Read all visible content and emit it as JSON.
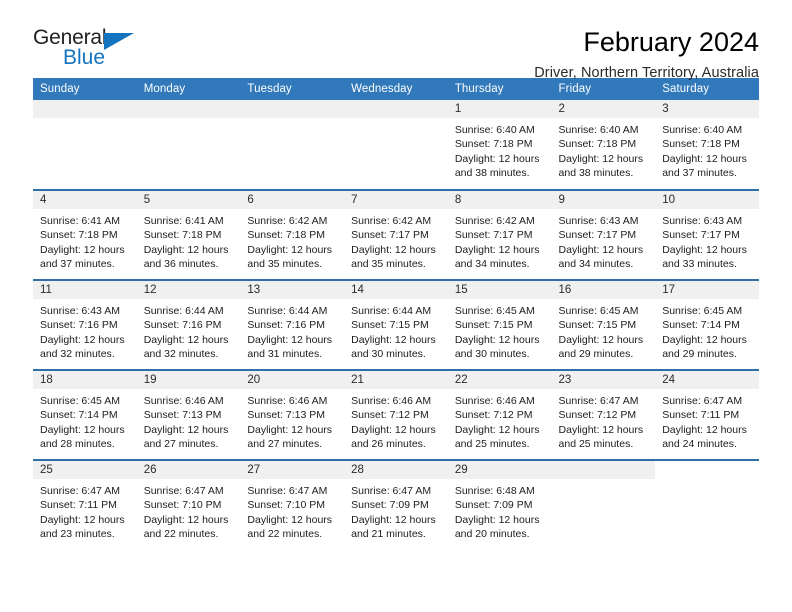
{
  "brand": {
    "name_part1": "General",
    "name_part2": "Blue",
    "triangle_icon": "triangle-icon",
    "accent_color": "#1574bf"
  },
  "header": {
    "title": "February 2024",
    "subtitle": "Driver, Northern Territory, Australia"
  },
  "colors": {
    "header_blue": "#3179ba",
    "row_border_blue": "#2e6fa7",
    "daynum_band": "#f0f0f0"
  },
  "weekdays": [
    "Sunday",
    "Monday",
    "Tuesday",
    "Wednesday",
    "Thursday",
    "Friday",
    "Saturday"
  ],
  "weeks": [
    [
      {
        "day": "",
        "blank": true
      },
      {
        "day": "",
        "blank": true
      },
      {
        "day": "",
        "blank": true
      },
      {
        "day": "",
        "blank": true
      },
      {
        "day": "1",
        "sunrise": "Sunrise: 6:40 AM",
        "sunset": "Sunset: 7:18 PM",
        "daylight1": "Daylight: 12 hours",
        "daylight2": "and 38 minutes."
      },
      {
        "day": "2",
        "sunrise": "Sunrise: 6:40 AM",
        "sunset": "Sunset: 7:18 PM",
        "daylight1": "Daylight: 12 hours",
        "daylight2": "and 38 minutes."
      },
      {
        "day": "3",
        "sunrise": "Sunrise: 6:40 AM",
        "sunset": "Sunset: 7:18 PM",
        "daylight1": "Daylight: 12 hours",
        "daylight2": "and 37 minutes."
      }
    ],
    [
      {
        "day": "4",
        "sunrise": "Sunrise: 6:41 AM",
        "sunset": "Sunset: 7:18 PM",
        "daylight1": "Daylight: 12 hours",
        "daylight2": "and 37 minutes."
      },
      {
        "day": "5",
        "sunrise": "Sunrise: 6:41 AM",
        "sunset": "Sunset: 7:18 PM",
        "daylight1": "Daylight: 12 hours",
        "daylight2": "and 36 minutes."
      },
      {
        "day": "6",
        "sunrise": "Sunrise: 6:42 AM",
        "sunset": "Sunset: 7:18 PM",
        "daylight1": "Daylight: 12 hours",
        "daylight2": "and 35 minutes."
      },
      {
        "day": "7",
        "sunrise": "Sunrise: 6:42 AM",
        "sunset": "Sunset: 7:17 PM",
        "daylight1": "Daylight: 12 hours",
        "daylight2": "and 35 minutes."
      },
      {
        "day": "8",
        "sunrise": "Sunrise: 6:42 AM",
        "sunset": "Sunset: 7:17 PM",
        "daylight1": "Daylight: 12 hours",
        "daylight2": "and 34 minutes."
      },
      {
        "day": "9",
        "sunrise": "Sunrise: 6:43 AM",
        "sunset": "Sunset: 7:17 PM",
        "daylight1": "Daylight: 12 hours",
        "daylight2": "and 34 minutes."
      },
      {
        "day": "10",
        "sunrise": "Sunrise: 6:43 AM",
        "sunset": "Sunset: 7:17 PM",
        "daylight1": "Daylight: 12 hours",
        "daylight2": "and 33 minutes."
      }
    ],
    [
      {
        "day": "11",
        "sunrise": "Sunrise: 6:43 AM",
        "sunset": "Sunset: 7:16 PM",
        "daylight1": "Daylight: 12 hours",
        "daylight2": "and 32 minutes."
      },
      {
        "day": "12",
        "sunrise": "Sunrise: 6:44 AM",
        "sunset": "Sunset: 7:16 PM",
        "daylight1": "Daylight: 12 hours",
        "daylight2": "and 32 minutes."
      },
      {
        "day": "13",
        "sunrise": "Sunrise: 6:44 AM",
        "sunset": "Sunset: 7:16 PM",
        "daylight1": "Daylight: 12 hours",
        "daylight2": "and 31 minutes."
      },
      {
        "day": "14",
        "sunrise": "Sunrise: 6:44 AM",
        "sunset": "Sunset: 7:15 PM",
        "daylight1": "Daylight: 12 hours",
        "daylight2": "and 30 minutes."
      },
      {
        "day": "15",
        "sunrise": "Sunrise: 6:45 AM",
        "sunset": "Sunset: 7:15 PM",
        "daylight1": "Daylight: 12 hours",
        "daylight2": "and 30 minutes."
      },
      {
        "day": "16",
        "sunrise": "Sunrise: 6:45 AM",
        "sunset": "Sunset: 7:15 PM",
        "daylight1": "Daylight: 12 hours",
        "daylight2": "and 29 minutes."
      },
      {
        "day": "17",
        "sunrise": "Sunrise: 6:45 AM",
        "sunset": "Sunset: 7:14 PM",
        "daylight1": "Daylight: 12 hours",
        "daylight2": "and 29 minutes."
      }
    ],
    [
      {
        "day": "18",
        "sunrise": "Sunrise: 6:45 AM",
        "sunset": "Sunset: 7:14 PM",
        "daylight1": "Daylight: 12 hours",
        "daylight2": "and 28 minutes."
      },
      {
        "day": "19",
        "sunrise": "Sunrise: 6:46 AM",
        "sunset": "Sunset: 7:13 PM",
        "daylight1": "Daylight: 12 hours",
        "daylight2": "and 27 minutes."
      },
      {
        "day": "20",
        "sunrise": "Sunrise: 6:46 AM",
        "sunset": "Sunset: 7:13 PM",
        "daylight1": "Daylight: 12 hours",
        "daylight2": "and 27 minutes."
      },
      {
        "day": "21",
        "sunrise": "Sunrise: 6:46 AM",
        "sunset": "Sunset: 7:12 PM",
        "daylight1": "Daylight: 12 hours",
        "daylight2": "and 26 minutes."
      },
      {
        "day": "22",
        "sunrise": "Sunrise: 6:46 AM",
        "sunset": "Sunset: 7:12 PM",
        "daylight1": "Daylight: 12 hours",
        "daylight2": "and 25 minutes."
      },
      {
        "day": "23",
        "sunrise": "Sunrise: 6:47 AM",
        "sunset": "Sunset: 7:12 PM",
        "daylight1": "Daylight: 12 hours",
        "daylight2": "and 25 minutes."
      },
      {
        "day": "24",
        "sunrise": "Sunrise: 6:47 AM",
        "sunset": "Sunset: 7:11 PM",
        "daylight1": "Daylight: 12 hours",
        "daylight2": "and 24 minutes."
      }
    ],
    [
      {
        "day": "25",
        "sunrise": "Sunrise: 6:47 AM",
        "sunset": "Sunset: 7:11 PM",
        "daylight1": "Daylight: 12 hours",
        "daylight2": "and 23 minutes."
      },
      {
        "day": "26",
        "sunrise": "Sunrise: 6:47 AM",
        "sunset": "Sunset: 7:10 PM",
        "daylight1": "Daylight: 12 hours",
        "daylight2": "and 22 minutes."
      },
      {
        "day": "27",
        "sunrise": "Sunrise: 6:47 AM",
        "sunset": "Sunset: 7:10 PM",
        "daylight1": "Daylight: 12 hours",
        "daylight2": "and 22 minutes."
      },
      {
        "day": "28",
        "sunrise": "Sunrise: 6:47 AM",
        "sunset": "Sunset: 7:09 PM",
        "daylight1": "Daylight: 12 hours",
        "daylight2": "and 21 minutes."
      },
      {
        "day": "29",
        "sunrise": "Sunrise: 6:48 AM",
        "sunset": "Sunset: 7:09 PM",
        "daylight1": "Daylight: 12 hours",
        "daylight2": "and 20 minutes."
      },
      {
        "day": "",
        "blank": true
      },
      {
        "day": "",
        "blank": true,
        "noband": true
      }
    ]
  ]
}
